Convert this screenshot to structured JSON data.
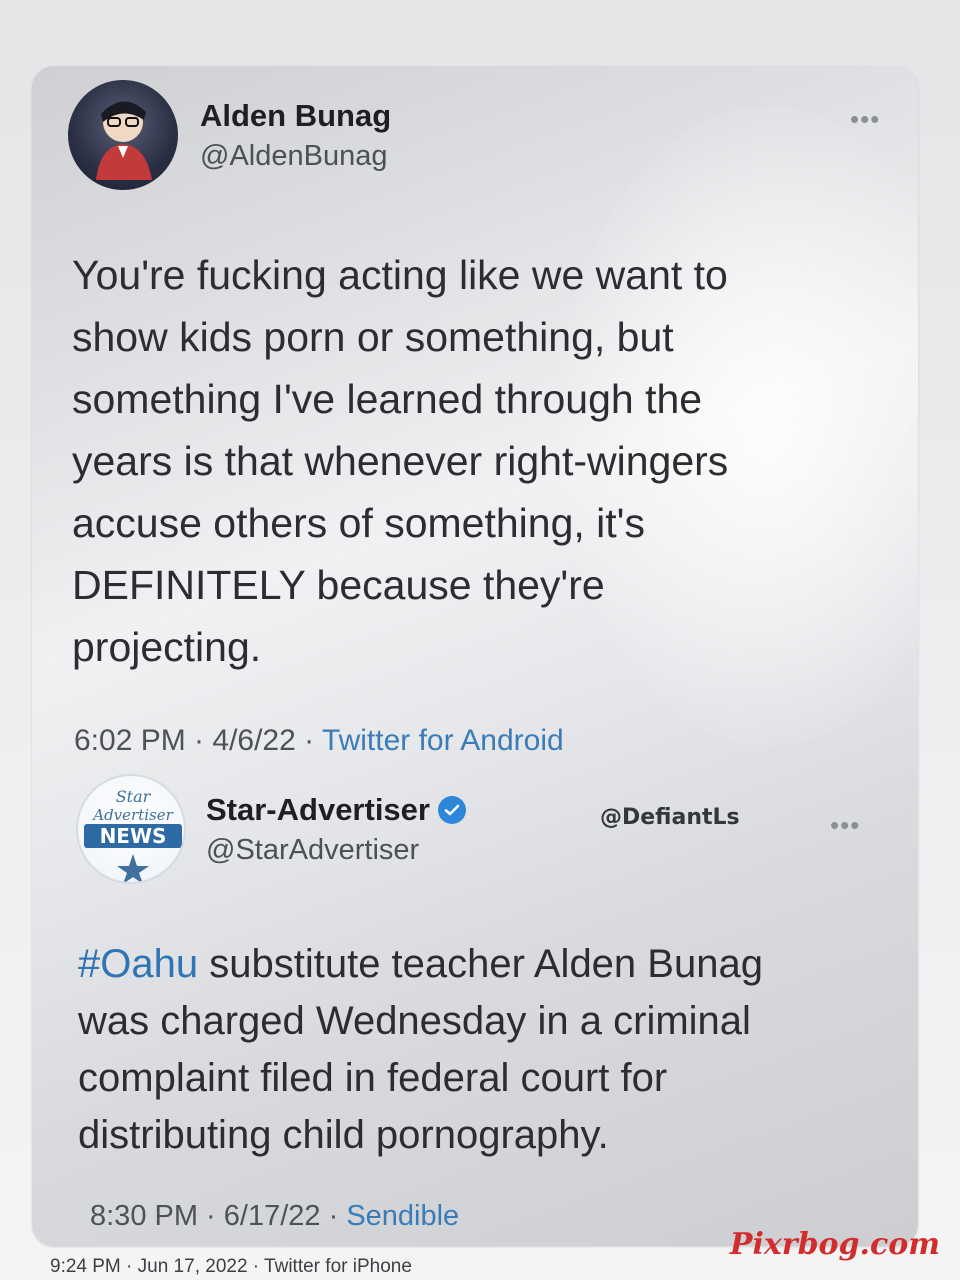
{
  "tweet": {
    "author_name": "Alden Bunag",
    "author_handle": "@AldenBunag",
    "more_label": "•••",
    "text": "You're fucking acting like we want to\nshow kids porn or something, but\nsomething I've learned through the\nyears is that whenever right-wingers\naccuse others of something, it's\nDEFINITELY because they're\nprojecting.",
    "time_date": "6:02 PM · 4/6/22 · ",
    "source": "Twitter for Android"
  },
  "quoted_tweet": {
    "author_name": "Star-Advertiser",
    "author_handle": "@StarAdvertiser",
    "avatar_text_top": "Star",
    "avatar_text_mid": "Advertiser",
    "avatar_text_news": "NEWS",
    "more_label": "•••",
    "hashtag": "#Oahu",
    "text_after_hashtag": " substitute teacher Alden Bunag\nwas charged Wednesday in a criminal\ncomplaint filed in federal court for\ndistributing child pornography.",
    "time_date": "8:30 PM · 6/17/22 · ",
    "source": "Sendible"
  },
  "overlay_handle": "@DefiantLs",
  "outer_meta": "9:24 PM · Jun 17, 2022 · Twitter for iPhone",
  "watermark": "Pixrbog.com",
  "colors": {
    "link_blue": "#2f74b5",
    "verified_blue": "#2c86d9",
    "watermark_red": "#d22c2c"
  },
  "icons": {
    "verified": "verified-badge-icon",
    "more": "more-options-icon"
  }
}
